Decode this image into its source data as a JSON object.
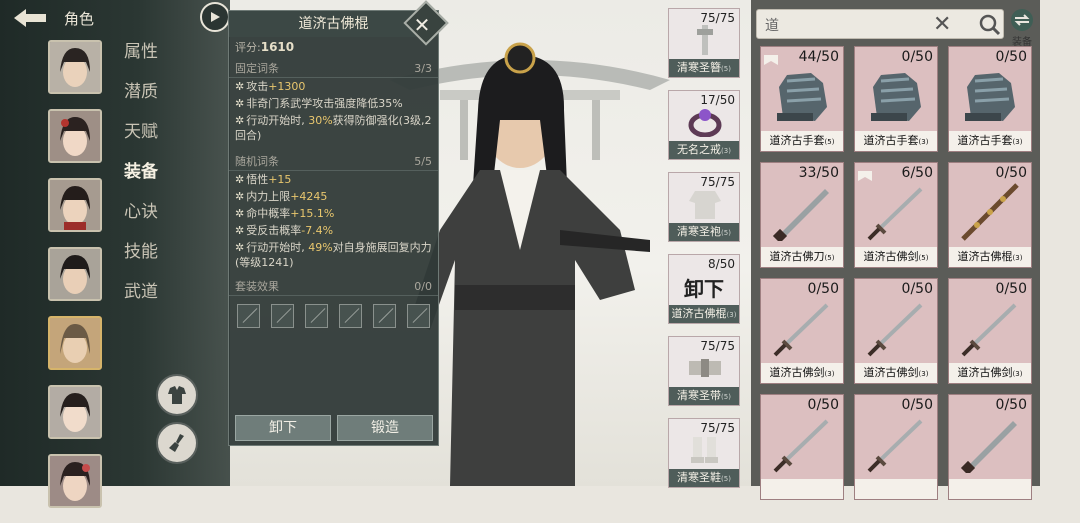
{
  "header": {
    "title": "角色"
  },
  "menu": [
    "属性",
    "潜质",
    "天赋",
    "装备",
    "心诀",
    "技能",
    "武道"
  ],
  "popup": {
    "title": "道济古佛棍",
    "score_label": "评分:",
    "score": "1610",
    "fixed_title": "固定词条",
    "fixed_count": "3/3",
    "fixed": [
      {
        "pre": "攻击",
        "hl": "+1300",
        "post": ""
      },
      {
        "pre": "非奇门系武学攻击强度降低35%",
        "hl": "",
        "post": ""
      },
      {
        "pre": "行动开始时, ",
        "hl": "30%",
        "post": "获得防御强化(3级,2回合)"
      }
    ],
    "random_title": "随机词条",
    "random_count": "5/5",
    "random": [
      {
        "pre": "悟性",
        "hl": "+15",
        "post": ""
      },
      {
        "pre": "内力上限",
        "hl": "+4245",
        "post": ""
      },
      {
        "pre": "命中概率",
        "hl": "+15.1%",
        "post": ""
      },
      {
        "pre": "受反击概率",
        "hl": "-7.4%",
        "post": ""
      },
      {
        "pre": "行动开始时, ",
        "hl": "49%",
        "post": "对自身施展回复内力(等级1241)"
      }
    ],
    "set_title": "套装效果",
    "set_count": "0/0",
    "unequip_label": "卸下",
    "forge_label": "锻造"
  },
  "equipped": [
    {
      "name": "清寒圣簪",
      "level": "(5)",
      "count": "75/75"
    },
    {
      "name": "无名之戒",
      "level": "(3)",
      "count": "17/50"
    },
    {
      "name": "清寒圣袍",
      "level": "(5)",
      "count": "75/75"
    },
    {
      "name": "道济古佛棍",
      "level": "(3)",
      "count": "8/50",
      "overlay": "卸下"
    },
    {
      "name": "清寒圣带",
      "level": "(5)",
      "count": "75/75"
    },
    {
      "name": "清寒圣鞋",
      "level": "(5)",
      "count": "75/75"
    }
  ],
  "search": {
    "value": "道"
  },
  "equip_toggle_label": "装备",
  "inventory": [
    {
      "name": "道济古手套",
      "level": "(5)",
      "count": "44/50",
      "kind": "glove",
      "tag": true
    },
    {
      "name": "道济古手套",
      "level": "(3)",
      "count": "0/50",
      "kind": "glove",
      "tag": false
    },
    {
      "name": "道济古手套",
      "level": "(3)",
      "count": "0/50",
      "kind": "glove",
      "tag": false
    },
    {
      "name": "道济古佛刀",
      "level": "(5)",
      "count": "33/50",
      "kind": "blade",
      "tag": false
    },
    {
      "name": "道济古佛剑",
      "level": "(5)",
      "count": "6/50",
      "kind": "sword",
      "tag": true
    },
    {
      "name": "道济古佛棍",
      "level": "(3)",
      "count": "0/50",
      "kind": "staff",
      "tag": false
    },
    {
      "name": "道济古佛剑",
      "level": "(3)",
      "count": "0/50",
      "kind": "sword",
      "tag": false
    },
    {
      "name": "道济古佛剑",
      "level": "(3)",
      "count": "0/50",
      "kind": "sword",
      "tag": false
    },
    {
      "name": "道济古佛剑",
      "level": "(3)",
      "count": "0/50",
      "kind": "sword",
      "tag": false
    },
    {
      "name": "",
      "level": "",
      "count": "0/50",
      "kind": "sword",
      "tag": false
    },
    {
      "name": "",
      "level": "",
      "count": "0/50",
      "kind": "sword",
      "tag": false
    },
    {
      "name": "",
      "level": "",
      "count": "0/50",
      "kind": "blade",
      "tag": false
    }
  ]
}
